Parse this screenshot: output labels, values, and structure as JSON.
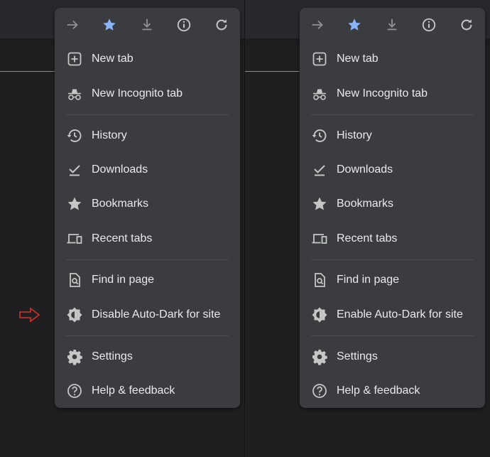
{
  "colors": {
    "menu_bg": "#3b3c3f",
    "icon": "#c4c7c5",
    "icon_dim": "#8f9194",
    "accent_star": "#8ab4f8",
    "text": "#e8eaed",
    "pointer_arrow": "#d93025"
  },
  "toolbar": {
    "icons": [
      "forward-arrow-icon",
      "bookmark-star-icon",
      "download-icon",
      "info-icon",
      "reload-icon"
    ]
  },
  "menus": [
    {
      "items": [
        {
          "icon": "new-tab-icon",
          "label": "New tab"
        },
        {
          "icon": "incognito-icon",
          "label": "New Incognito tab"
        },
        {
          "icon": "history-icon",
          "label": "History"
        },
        {
          "icon": "downloads-icon",
          "label": "Downloads"
        },
        {
          "icon": "bookmarks-star-icon",
          "label": "Bookmarks"
        },
        {
          "icon": "recent-tabs-icon",
          "label": "Recent tabs"
        },
        {
          "icon": "find-in-page-icon",
          "label": "Find in page"
        },
        {
          "icon": "auto-dark-icon",
          "label": "Disable Auto-Dark for site"
        },
        {
          "icon": "settings-gear-icon",
          "label": "Settings"
        },
        {
          "icon": "help-icon",
          "label": "Help & feedback"
        }
      ]
    },
    {
      "items": [
        {
          "icon": "new-tab-icon",
          "label": "New tab"
        },
        {
          "icon": "incognito-icon",
          "label": "New Incognito tab"
        },
        {
          "icon": "history-icon",
          "label": "History"
        },
        {
          "icon": "downloads-icon",
          "label": "Downloads"
        },
        {
          "icon": "bookmarks-star-icon",
          "label": "Bookmarks"
        },
        {
          "icon": "recent-tabs-icon",
          "label": "Recent tabs"
        },
        {
          "icon": "find-in-page-icon",
          "label": "Find in page"
        },
        {
          "icon": "auto-dark-icon",
          "label": "Enable Auto-Dark for site"
        },
        {
          "icon": "settings-gear-icon",
          "label": "Settings"
        },
        {
          "icon": "help-icon",
          "label": "Help & feedback"
        }
      ]
    }
  ]
}
